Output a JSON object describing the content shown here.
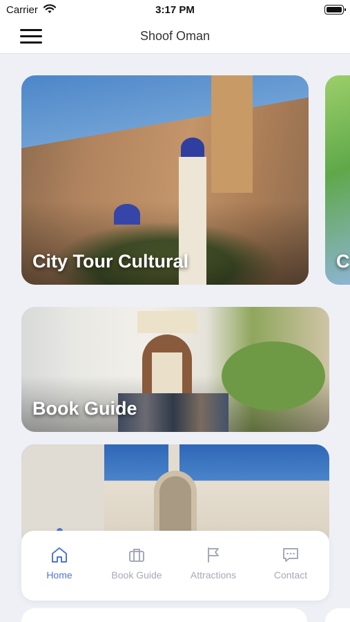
{
  "status_bar": {
    "carrier": "Carrier",
    "time": "3:17 PM"
  },
  "header": {
    "title": "Shoof Oman",
    "menu_icon": "hamburger-menu-icon"
  },
  "cards": [
    {
      "label": "City Tour Cultural"
    },
    {
      "label": "C"
    },
    {
      "label": "Book Guide"
    },
    {
      "label": ""
    }
  ],
  "tab_bar": {
    "active_index": 0,
    "accent_color": "#4f74d6",
    "inactive_color": "#a6a9b8",
    "tabs": [
      {
        "label": "Home",
        "icon": "home-icon"
      },
      {
        "label": "Book Guide",
        "icon": "briefcase-icon"
      },
      {
        "label": "Attractions",
        "icon": "flag-icon"
      },
      {
        "label": "Contact",
        "icon": "chat-icon"
      }
    ]
  }
}
